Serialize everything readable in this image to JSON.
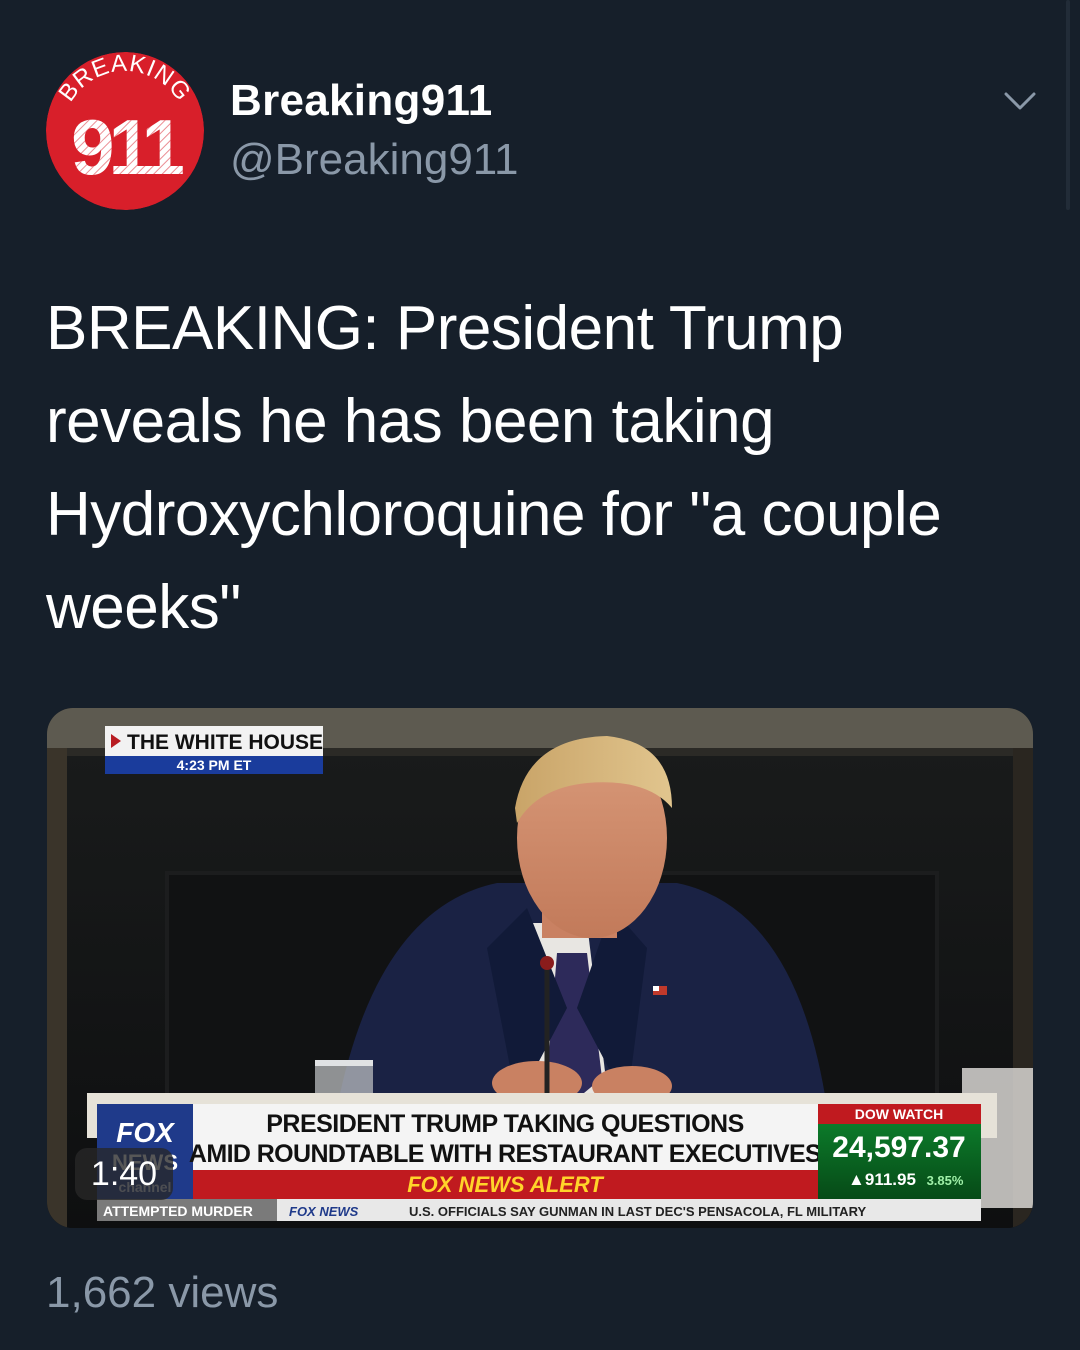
{
  "tweet": {
    "avatar": {
      "top_text": "BREAKING",
      "number_text": "911",
      "color": "#d81f2a"
    },
    "display_name": "Breaking911",
    "handle": "@Breaking911",
    "text": "BREAKING: President Trump reveals he has been taking Hydroxychloroquine for \"a couple weeks\"",
    "menu_icon": "chevron-down-icon",
    "video": {
      "location_bug": {
        "title": "THE WHITE HOUSE",
        "time": "4:23 PM ET"
      },
      "channel_logo": "FOX NEWS channel",
      "headline_line1": "PRESIDENT TRUMP TAKING QUESTIONS",
      "headline_line2": "AMID ROUNDTABLE WITH RESTAURANT EXECUTIVES",
      "alert_label": "FOX NEWS ALERT",
      "ticker": {
        "label": "DOW WATCH",
        "value": "24,597.37",
        "change": "▲911.95",
        "change_pct": "3.85%"
      },
      "crawl_label": "ATTEMPTED MURDER",
      "crawl_logo": "FOX NEWS",
      "crawl_text": "U.S. OFFICIALS SAY GUNMAN IN LAST DEC'S PENSACOLA, FL MILITARY",
      "duration": "1:40"
    },
    "views": "1,662 views"
  }
}
